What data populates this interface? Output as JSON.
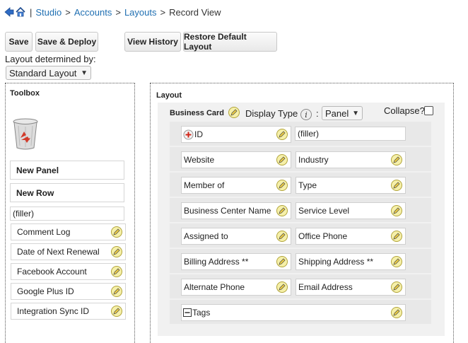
{
  "breadcrumb": {
    "separator_first": "|",
    "items": [
      "Studio",
      "Accounts",
      "Layouts"
    ],
    "current": "Record View",
    "arrow": ">"
  },
  "buttons": {
    "save": "Save",
    "save_deploy": "Save & Deploy",
    "view_history": "View History",
    "restore": "Restore Default Layout"
  },
  "layout_determined_by": {
    "label": "Layout determined by:",
    "selected": "Standard Layout"
  },
  "toolbox": {
    "title": "Toolbox",
    "new_panel": "New Panel",
    "new_row": "New Row",
    "filler": "(filler)",
    "fields": [
      "Comment Log",
      "Date of Next Renewal",
      "Facebook Account",
      "Google Plus ID",
      "Integration Sync ID"
    ]
  },
  "layout": {
    "title": "Layout",
    "panel_name": "Business Card",
    "display_type_label": "Display Type",
    "colon": ":",
    "display_type_value": "Panel",
    "collapse_label": "Collapse?",
    "rows": [
      [
        "ID",
        "(filler)"
      ],
      [
        "Website",
        "Industry"
      ],
      [
        "Member of",
        "Type"
      ],
      [
        "Business Center Name",
        "Service Level"
      ],
      [
        "Assigned to",
        "Office Phone"
      ],
      [
        "Billing Address **",
        "Shipping Address **"
      ],
      [
        "Alternate Phone",
        "Email Address"
      ]
    ],
    "full_row": "Tags"
  },
  "icons": {
    "back": "back-arrow-icon",
    "home": "home-icon",
    "trash": "recycle-bin-icon",
    "edit": "pencil-icon",
    "info": "info-icon",
    "add": "plus-icon",
    "minus": "minus-icon"
  }
}
